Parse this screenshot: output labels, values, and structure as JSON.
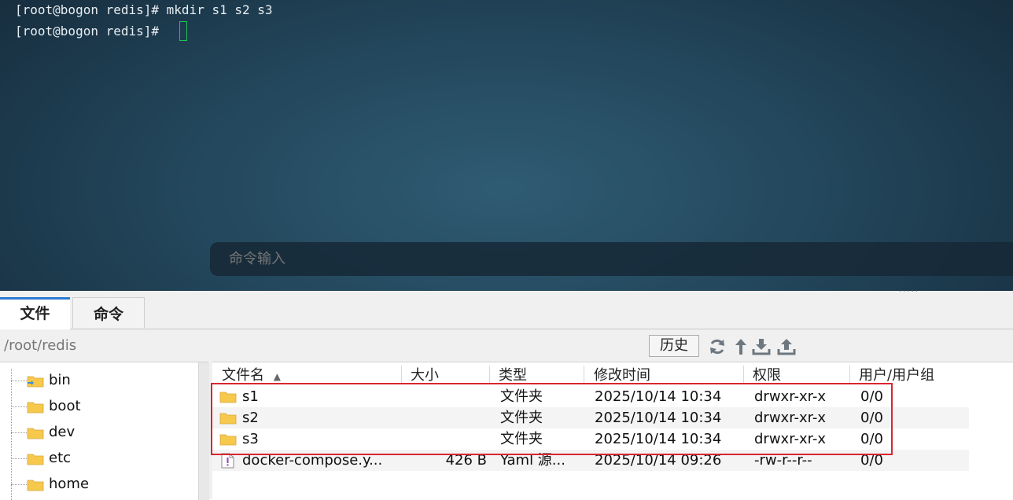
{
  "terminal": {
    "lines": [
      "[root@bogon redis]# mkdir s1 s2 s3",
      "[root@bogon redis]# "
    ],
    "command_placeholder": "命令输入",
    "cursor_color": "#21c45a"
  },
  "tabs": [
    {
      "label": "文件",
      "active": true
    },
    {
      "label": "命令",
      "active": false
    }
  ],
  "pathbar": {
    "path": "/root/redis",
    "history_label": "历史",
    "tools": [
      "refresh-icon",
      "up-arrow-icon",
      "download-icon",
      "upload-icon"
    ]
  },
  "tree": {
    "items": [
      {
        "label": "bin",
        "icon": "folder-link-icon"
      },
      {
        "label": "boot",
        "icon": "folder-icon"
      },
      {
        "label": "dev",
        "icon": "folder-icon"
      },
      {
        "label": "etc",
        "icon": "folder-icon"
      },
      {
        "label": "home",
        "icon": "folder-icon"
      }
    ]
  },
  "files": {
    "columns": [
      "文件名",
      "大小",
      "类型",
      "修改时间",
      "权限",
      "用户/用户组"
    ],
    "sort_indicator": "▲",
    "rows": [
      {
        "name": "s1",
        "size": "",
        "type": "文件夹",
        "modified": "2025/10/14 10:34",
        "perm": "drwxr-xr-x",
        "owner": "0/0",
        "icon": "folder-icon"
      },
      {
        "name": "s2",
        "size": "",
        "type": "文件夹",
        "modified": "2025/10/14 10:34",
        "perm": "drwxr-xr-x",
        "owner": "0/0",
        "icon": "folder-icon"
      },
      {
        "name": "s3",
        "size": "",
        "type": "文件夹",
        "modified": "2025/10/14 10:34",
        "perm": "drwxr-xr-x",
        "owner": "0/0",
        "icon": "folder-icon"
      },
      {
        "name": "docker-compose.y...",
        "size": "426 B",
        "type": "Yaml 源...",
        "modified": "2025/10/14 09:26",
        "perm": "-rw-r--r--",
        "owner": "0/0",
        "icon": "yaml-file-icon"
      }
    ]
  },
  "colors": {
    "highlight_border": "#d9252f",
    "active_tab_accent": "#2a7bd3",
    "folder": "#f6c84c"
  }
}
